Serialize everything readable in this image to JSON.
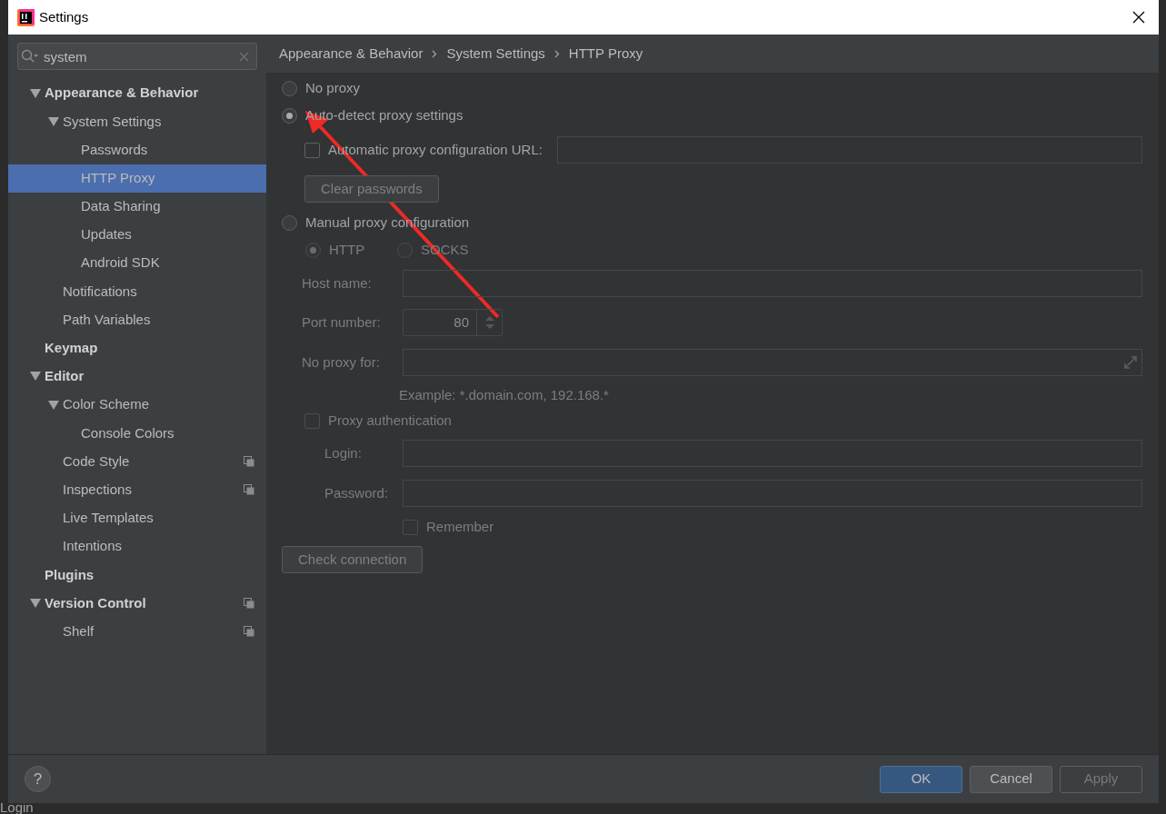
{
  "background_text": "Login",
  "window": {
    "title": "Settings"
  },
  "search": {
    "value": "system"
  },
  "tree": [
    {
      "label": "Appearance & Behavior",
      "expanded": true,
      "selected": false,
      "children": [
        {
          "label": "System Settings",
          "expanded": true,
          "selected": false,
          "children": [
            {
              "label": "Passwords",
              "selected": false
            },
            {
              "label": "HTTP Proxy",
              "selected": true
            },
            {
              "label": "Data Sharing",
              "selected": false
            },
            {
              "label": "Updates",
              "selected": false
            },
            {
              "label": "Android SDK",
              "selected": false
            }
          ]
        },
        {
          "label": "Notifications",
          "selected": false
        },
        {
          "label": "Path Variables",
          "selected": false
        }
      ]
    },
    {
      "label": "Keymap",
      "selected": false
    },
    {
      "label": "Editor",
      "expanded": true,
      "selected": false,
      "children": [
        {
          "label": "Color Scheme",
          "expanded": true,
          "selected": false,
          "children": [
            {
              "label": "Console Colors",
              "selected": false
            }
          ]
        },
        {
          "label": "Code Style",
          "selected": false,
          "project_level": true
        },
        {
          "label": "Inspections",
          "selected": false,
          "project_level": true
        },
        {
          "label": "Live Templates",
          "selected": false
        },
        {
          "label": "Intentions",
          "selected": false
        }
      ]
    },
    {
      "label": "Plugins",
      "selected": false
    },
    {
      "label": "Version Control",
      "expanded": true,
      "selected": false,
      "project_level": true,
      "children": [
        {
          "label": "Shelf",
          "selected": false,
          "project_level": true
        }
      ]
    }
  ],
  "breadcrumb": [
    "Appearance & Behavior",
    "System Settings",
    "HTTP Proxy"
  ],
  "proxy_modes": [
    {
      "label": "No proxy",
      "selected": false
    },
    {
      "label": "Auto-detect proxy settings",
      "selected": true
    },
    {
      "label": "Manual proxy configuration",
      "selected": false
    }
  ],
  "auto_config_url": {
    "label": "Automatic proxy configuration URL:",
    "checked": false
  },
  "clear_passwords_button": "Clear passwords",
  "manual": {
    "disabled": true,
    "protocols": [
      {
        "label": "HTTP",
        "selected": true
      },
      {
        "label": "SOCKS",
        "selected": false
      }
    ],
    "host_name": {
      "label": "Host name:"
    },
    "port_number": {
      "label": "Port number:",
      "value": "80"
    },
    "no_proxy_for": {
      "label": "No proxy for:"
    },
    "example": "Example: *.domain.com, 192.168.*",
    "proxy_authentication": {
      "label": "Proxy authentication",
      "checked": false
    },
    "login": {
      "label": "Login:"
    },
    "password": {
      "label": "Password:"
    },
    "remember": {
      "label": "Remember",
      "checked": false
    }
  },
  "check_connection_button": "Check connection",
  "help_button": "?",
  "buttons": [
    {
      "label": "OK",
      "kind": "primary"
    },
    {
      "label": "Cancel",
      "kind": "normal"
    },
    {
      "label": "Apply",
      "kind": "disabled"
    }
  ]
}
